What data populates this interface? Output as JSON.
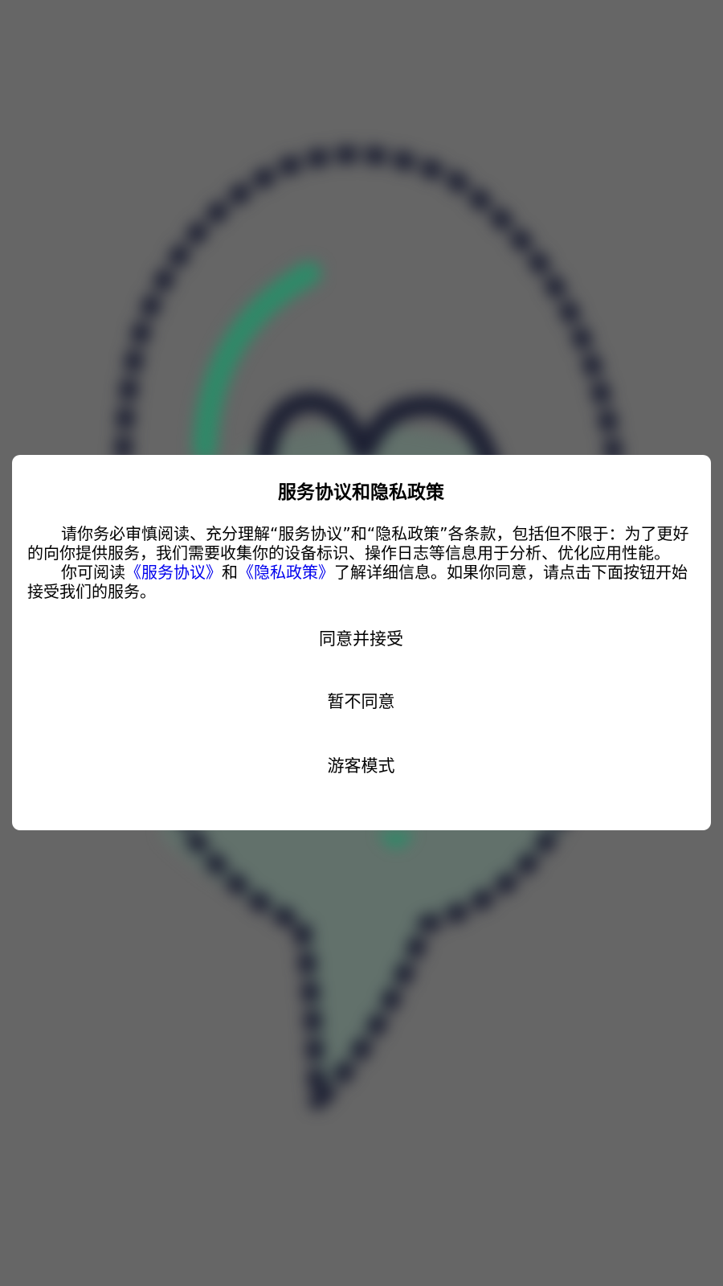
{
  "dialog": {
    "title": "服务协议和隐私政策",
    "paragraph1": "请你务必审慎阅读、充分理解“服务协议”和“隐私政策”各条款，包括但不限于：为了更好的向你提供服务，我们需要收集你的设备标识、操作日志等信息用于分析、优化应用性能。",
    "paragraph2": {
      "prefix": "你可阅读",
      "service_link": "《服务协议》",
      "middle": "和",
      "privacy_link": "《隐私政策》",
      "suffix": "了解详细信息。如果你同意，请点击下面按钮开始接受我们的服务。"
    },
    "buttons": {
      "agree": "同意并接受",
      "disagree": "暂不同意",
      "guest": "游客模式"
    }
  },
  "colors": {
    "overlay": "#666666",
    "dialog_background": "#ffffff",
    "link": "#0000ee",
    "logo_outline": "#1d2033",
    "logo_green": "#2e8a68"
  },
  "background": {
    "icon": "blurred-app-logo-icon"
  }
}
